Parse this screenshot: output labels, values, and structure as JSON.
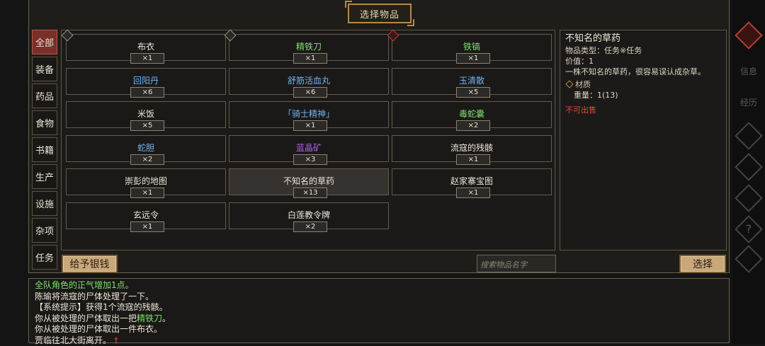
{
  "dialog": {
    "title": "选择物品"
  },
  "categories": [
    {
      "label": "全部",
      "active": true
    },
    {
      "label": "装备",
      "active": false
    },
    {
      "label": "药品",
      "active": false
    },
    {
      "label": "食物",
      "active": false
    },
    {
      "label": "书籍",
      "active": false
    },
    {
      "label": "生产",
      "active": false
    },
    {
      "label": "设施",
      "active": false
    },
    {
      "label": "杂项",
      "active": false
    },
    {
      "label": "任务",
      "active": false
    }
  ],
  "items": [
    {
      "name": "布衣",
      "count": "×1",
      "quality": "white",
      "badge": "white"
    },
    {
      "name": "精铁刀",
      "count": "×1",
      "quality": "green",
      "badge": "white"
    },
    {
      "name": "铁镐",
      "count": "×1",
      "quality": "green",
      "badge": "red"
    },
    {
      "name": "回阳丹",
      "count": "×6",
      "quality": "blue"
    },
    {
      "name": "舒筋活血丸",
      "count": "×6",
      "quality": "blue"
    },
    {
      "name": "玉清散",
      "count": "×5",
      "quality": "blue"
    },
    {
      "name": "米饭",
      "count": "×5",
      "quality": "white"
    },
    {
      "name": "「骑士精神」",
      "count": "×1",
      "quality": "blue"
    },
    {
      "name": "毒蛇囊",
      "count": "×2",
      "quality": "green"
    },
    {
      "name": "蛇胆",
      "count": "×2",
      "quality": "blue"
    },
    {
      "name": "蓝晶矿",
      "count": "×3",
      "quality": "purple"
    },
    {
      "name": "流寇的残骸",
      "count": "×1",
      "quality": "white"
    },
    {
      "name": "崇彭的地图",
      "count": "×1",
      "quality": "white"
    },
    {
      "name": "不知名的草药",
      "count": "×13",
      "quality": "white",
      "selected": true
    },
    {
      "name": "赵家寨宝图",
      "count": "×1",
      "quality": "white"
    },
    {
      "name": "玄远令",
      "count": "×1",
      "quality": "white"
    },
    {
      "name": "白莲教令牌",
      "count": "×2",
      "quality": "white"
    }
  ],
  "detail": {
    "name": "不知名的草药",
    "type_line": "物品类型：任务※任务",
    "price_line": "价值：1",
    "description": "一株不知名的草药，很容易误认成杂草。",
    "section": "材质",
    "weight_line": "重量：1(13)",
    "warning": "不可出售"
  },
  "buttons": {
    "give_money": "给予银钱",
    "select": "选择"
  },
  "search": {
    "placeholder": "搜索物品名字"
  },
  "log": {
    "line1": "全队角色的正气增加1点。",
    "line2": "陈瑜将流寇的尸体处理了一下。",
    "line3": "【系统提示】获得1个流寇的残骸。",
    "line4_pre": "你从被处理的尸体取出一把",
    "line4_hl": "精铁刀",
    "line4_post": "。",
    "line5": "你从被处理的尸体取出一件布衣。",
    "line6": "贾临往北大街离开。",
    "line6_mark": "†"
  },
  "rail": {
    "info": "信息",
    "history": "经历",
    "help": "?"
  },
  "colors": {
    "green": "#7fe070",
    "blue": "#6fb3ef",
    "purple": "#b060e8",
    "red": "#e2483c",
    "accent": "#c8a87a"
  }
}
